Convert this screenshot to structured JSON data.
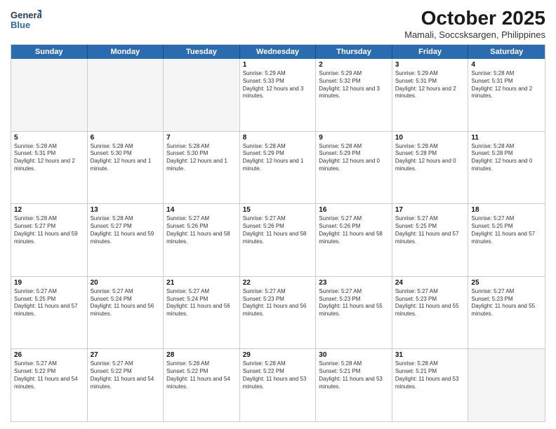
{
  "logo": {
    "line1": "General",
    "line2": "Blue"
  },
  "title": "October 2025",
  "location": "Mamali, Soccsksargen, Philippines",
  "days": [
    "Sunday",
    "Monday",
    "Tuesday",
    "Wednesday",
    "Thursday",
    "Friday",
    "Saturday"
  ],
  "rows": [
    [
      {
        "day": "",
        "sunrise": "",
        "sunset": "",
        "daylight": "",
        "empty": true
      },
      {
        "day": "",
        "sunrise": "",
        "sunset": "",
        "daylight": "",
        "empty": true
      },
      {
        "day": "",
        "sunrise": "",
        "sunset": "",
        "daylight": "",
        "empty": true
      },
      {
        "day": "1",
        "sunrise": "Sunrise: 5:29 AM",
        "sunset": "Sunset: 5:33 PM",
        "daylight": "Daylight: 12 hours and 3 minutes."
      },
      {
        "day": "2",
        "sunrise": "Sunrise: 5:29 AM",
        "sunset": "Sunset: 5:32 PM",
        "daylight": "Daylight: 12 hours and 3 minutes."
      },
      {
        "day": "3",
        "sunrise": "Sunrise: 5:29 AM",
        "sunset": "Sunset: 5:31 PM",
        "daylight": "Daylight: 12 hours and 2 minutes."
      },
      {
        "day": "4",
        "sunrise": "Sunrise: 5:28 AM",
        "sunset": "Sunset: 5:31 PM",
        "daylight": "Daylight: 12 hours and 2 minutes."
      }
    ],
    [
      {
        "day": "5",
        "sunrise": "Sunrise: 5:28 AM",
        "sunset": "Sunset: 5:31 PM",
        "daylight": "Daylight: 12 hours and 2 minutes."
      },
      {
        "day": "6",
        "sunrise": "Sunrise: 5:28 AM",
        "sunset": "Sunset: 5:30 PM",
        "daylight": "Daylight: 12 hours and 1 minute."
      },
      {
        "day": "7",
        "sunrise": "Sunrise: 5:28 AM",
        "sunset": "Sunset: 5:30 PM",
        "daylight": "Daylight: 12 hours and 1 minute."
      },
      {
        "day": "8",
        "sunrise": "Sunrise: 5:28 AM",
        "sunset": "Sunset: 5:29 PM",
        "daylight": "Daylight: 12 hours and 1 minute."
      },
      {
        "day": "9",
        "sunrise": "Sunrise: 5:28 AM",
        "sunset": "Sunset: 5:29 PM",
        "daylight": "Daylight: 12 hours and 0 minutes."
      },
      {
        "day": "10",
        "sunrise": "Sunrise: 5:28 AM",
        "sunset": "Sunset: 5:28 PM",
        "daylight": "Daylight: 12 hours and 0 minutes."
      },
      {
        "day": "11",
        "sunrise": "Sunrise: 5:28 AM",
        "sunset": "Sunset: 5:28 PM",
        "daylight": "Daylight: 12 hours and 0 minutes."
      }
    ],
    [
      {
        "day": "12",
        "sunrise": "Sunrise: 5:28 AM",
        "sunset": "Sunset: 5:27 PM",
        "daylight": "Daylight: 11 hours and 59 minutes."
      },
      {
        "day": "13",
        "sunrise": "Sunrise: 5:28 AM",
        "sunset": "Sunset: 5:27 PM",
        "daylight": "Daylight: 11 hours and 59 minutes."
      },
      {
        "day": "14",
        "sunrise": "Sunrise: 5:27 AM",
        "sunset": "Sunset: 5:26 PM",
        "daylight": "Daylight: 11 hours and 58 minutes."
      },
      {
        "day": "15",
        "sunrise": "Sunrise: 5:27 AM",
        "sunset": "Sunset: 5:26 PM",
        "daylight": "Daylight: 11 hours and 58 minutes."
      },
      {
        "day": "16",
        "sunrise": "Sunrise: 5:27 AM",
        "sunset": "Sunset: 5:26 PM",
        "daylight": "Daylight: 11 hours and 58 minutes."
      },
      {
        "day": "17",
        "sunrise": "Sunrise: 5:27 AM",
        "sunset": "Sunset: 5:25 PM",
        "daylight": "Daylight: 11 hours and 57 minutes."
      },
      {
        "day": "18",
        "sunrise": "Sunrise: 5:27 AM",
        "sunset": "Sunset: 5:25 PM",
        "daylight": "Daylight: 11 hours and 57 minutes."
      }
    ],
    [
      {
        "day": "19",
        "sunrise": "Sunrise: 5:27 AM",
        "sunset": "Sunset: 5:25 PM",
        "daylight": "Daylight: 11 hours and 57 minutes."
      },
      {
        "day": "20",
        "sunrise": "Sunrise: 5:27 AM",
        "sunset": "Sunset: 5:24 PM",
        "daylight": "Daylight: 11 hours and 56 minutes."
      },
      {
        "day": "21",
        "sunrise": "Sunrise: 5:27 AM",
        "sunset": "Sunset: 5:24 PM",
        "daylight": "Daylight: 11 hours and 56 minutes."
      },
      {
        "day": "22",
        "sunrise": "Sunrise: 5:27 AM",
        "sunset": "Sunset: 5:23 PM",
        "daylight": "Daylight: 11 hours and 56 minutes."
      },
      {
        "day": "23",
        "sunrise": "Sunrise: 5:27 AM",
        "sunset": "Sunset: 5:23 PM",
        "daylight": "Daylight: 11 hours and 55 minutes."
      },
      {
        "day": "24",
        "sunrise": "Sunrise: 5:27 AM",
        "sunset": "Sunset: 5:23 PM",
        "daylight": "Daylight: 11 hours and 55 minutes."
      },
      {
        "day": "25",
        "sunrise": "Sunrise: 5:27 AM",
        "sunset": "Sunset: 5:23 PM",
        "daylight": "Daylight: 11 hours and 55 minutes."
      }
    ],
    [
      {
        "day": "26",
        "sunrise": "Sunrise: 5:27 AM",
        "sunset": "Sunset: 5:22 PM",
        "daylight": "Daylight: 11 hours and 54 minutes."
      },
      {
        "day": "27",
        "sunrise": "Sunrise: 5:27 AM",
        "sunset": "Sunset: 5:22 PM",
        "daylight": "Daylight: 11 hours and 54 minutes."
      },
      {
        "day": "28",
        "sunrise": "Sunrise: 5:28 AM",
        "sunset": "Sunset: 5:22 PM",
        "daylight": "Daylight: 11 hours and 54 minutes."
      },
      {
        "day": "29",
        "sunrise": "Sunrise: 5:28 AM",
        "sunset": "Sunset: 5:22 PM",
        "daylight": "Daylight: 11 hours and 53 minutes."
      },
      {
        "day": "30",
        "sunrise": "Sunrise: 5:28 AM",
        "sunset": "Sunset: 5:21 PM",
        "daylight": "Daylight: 11 hours and 53 minutes."
      },
      {
        "day": "31",
        "sunrise": "Sunrise: 5:28 AM",
        "sunset": "Sunset: 5:21 PM",
        "daylight": "Daylight: 11 hours and 53 minutes."
      },
      {
        "day": "",
        "sunrise": "",
        "sunset": "",
        "daylight": "",
        "empty": true
      }
    ]
  ]
}
